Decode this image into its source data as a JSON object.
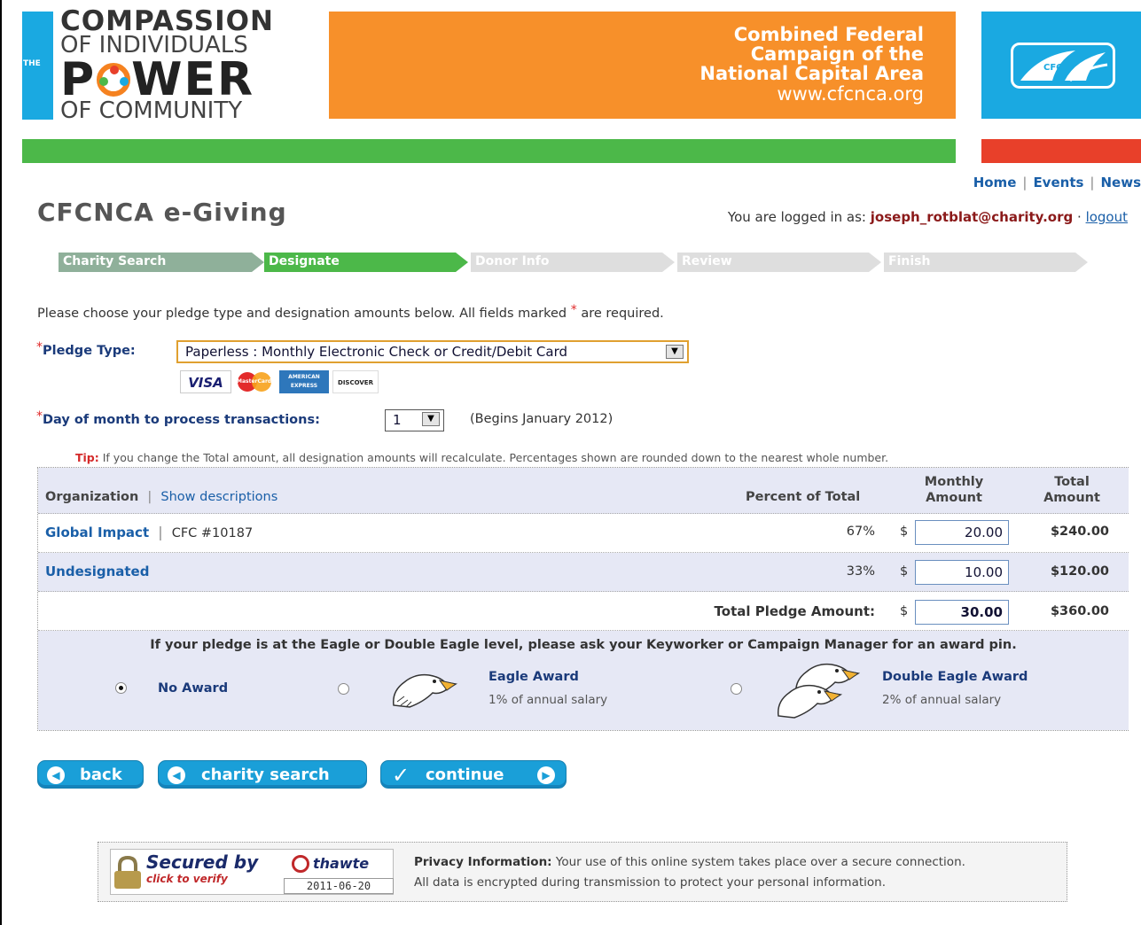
{
  "header": {
    "logo_the": "THE",
    "logo_line1": "COMPASSION",
    "logo_line2": "OF INDIVIDUALS",
    "logo_line3a": "P",
    "logo_line3b": "WER",
    "logo_line4": "OF COMMUNITY",
    "campaign_line1": "Combined Federal",
    "campaign_line2": "Campaign of the",
    "campaign_line3": "National Capital Area",
    "campaign_url": "www.cfcnca.org",
    "cfc_logo_text": "CFC",
    "colors": {
      "orange": "#f7902a",
      "blue": "#1aa9e1",
      "green": "#4cb849",
      "red": "#e8402a"
    }
  },
  "topnav": {
    "home": "Home",
    "events": "Events",
    "news": "News",
    "separator": "|"
  },
  "page_title": "CFCNCA e-Giving",
  "login": {
    "prefix": "You are logged in as:",
    "user": "joseph_rotblat@charity.org",
    "dot": "·",
    "logout": "logout"
  },
  "steps": [
    {
      "label": "Charity Search",
      "state": "done",
      "color": "#8fb09a"
    },
    {
      "label": "Designate",
      "state": "current",
      "color": "#4cb849"
    },
    {
      "label": "Donor Info",
      "state": "todo",
      "color": "#dedede"
    },
    {
      "label": "Review",
      "state": "todo",
      "color": "#dedede"
    },
    {
      "label": "Finish",
      "state": "todo",
      "color": "#dedede"
    }
  ],
  "intro": {
    "text": "Please choose your pledge type and designation amounts below. All fields marked",
    "req": "*",
    "tail": "are required."
  },
  "pledge_type": {
    "req": "*",
    "label": "Pledge Type:",
    "value": "Paperless : Monthly Electronic Check or Credit/Debit Card",
    "arrow": "▼",
    "cards": [
      "VISA",
      "MasterCard",
      "AMERICAN EXPRESS",
      "DISCOVER"
    ]
  },
  "day_of_month": {
    "req": "*",
    "label": "Day of month to process transactions:",
    "value": "1",
    "arrow": "▼",
    "note": "(Begins January 2012)"
  },
  "tip": {
    "label": "Tip:",
    "text": "If you change the Total amount, all designation amounts will recalculate. Percentages shown are rounded down to the nearest whole number."
  },
  "table": {
    "header": {
      "organization": "Organization",
      "sep": "|",
      "show_descriptions": "Show descriptions",
      "percent": "Percent of Total",
      "monthly1": "Monthly",
      "monthly2": "Amount",
      "total1": "Total",
      "total2": "Amount"
    },
    "rows": [
      {
        "name": "Global Impact",
        "sep": "|",
        "cfc": "CFC #10187",
        "percent": "67%",
        "currency": "$",
        "monthly": "20.00",
        "total": "$240.00"
      },
      {
        "name": "Undesignated",
        "percent": "33%",
        "currency": "$",
        "monthly": "10.00",
        "total": "$120.00"
      }
    ],
    "total_row": {
      "label": "Total Pledge Amount:",
      "currency": "$",
      "monthly": "30.00",
      "total": "$360.00"
    },
    "award_note": "If your pledge is at the Eagle or Double Eagle level, please ask your Keyworker or Campaign Manager for an award pin.",
    "awards": [
      {
        "title": "No Award",
        "sub": "",
        "selected": true
      },
      {
        "title": "Eagle Award",
        "sub": "1% of annual salary",
        "selected": false
      },
      {
        "title": "Double Eagle Award",
        "sub": "2% of annual salary",
        "selected": false
      }
    ]
  },
  "buttons": {
    "back": "back",
    "charity_search": "charity search",
    "continue": "continue",
    "left_arrow": "◀",
    "right_arrow": "▶",
    "check": "✓"
  },
  "security": {
    "seal_title": "Secured by",
    "seal_brand": "thawte",
    "seal_click": "click to verify",
    "seal_date": "2011-06-20",
    "privacy_label": "Privacy Information:",
    "privacy_text1": "Your use of this online system takes place over a secure connection.",
    "privacy_text2": "All data is encrypted during transmission to protect your personal information."
  }
}
